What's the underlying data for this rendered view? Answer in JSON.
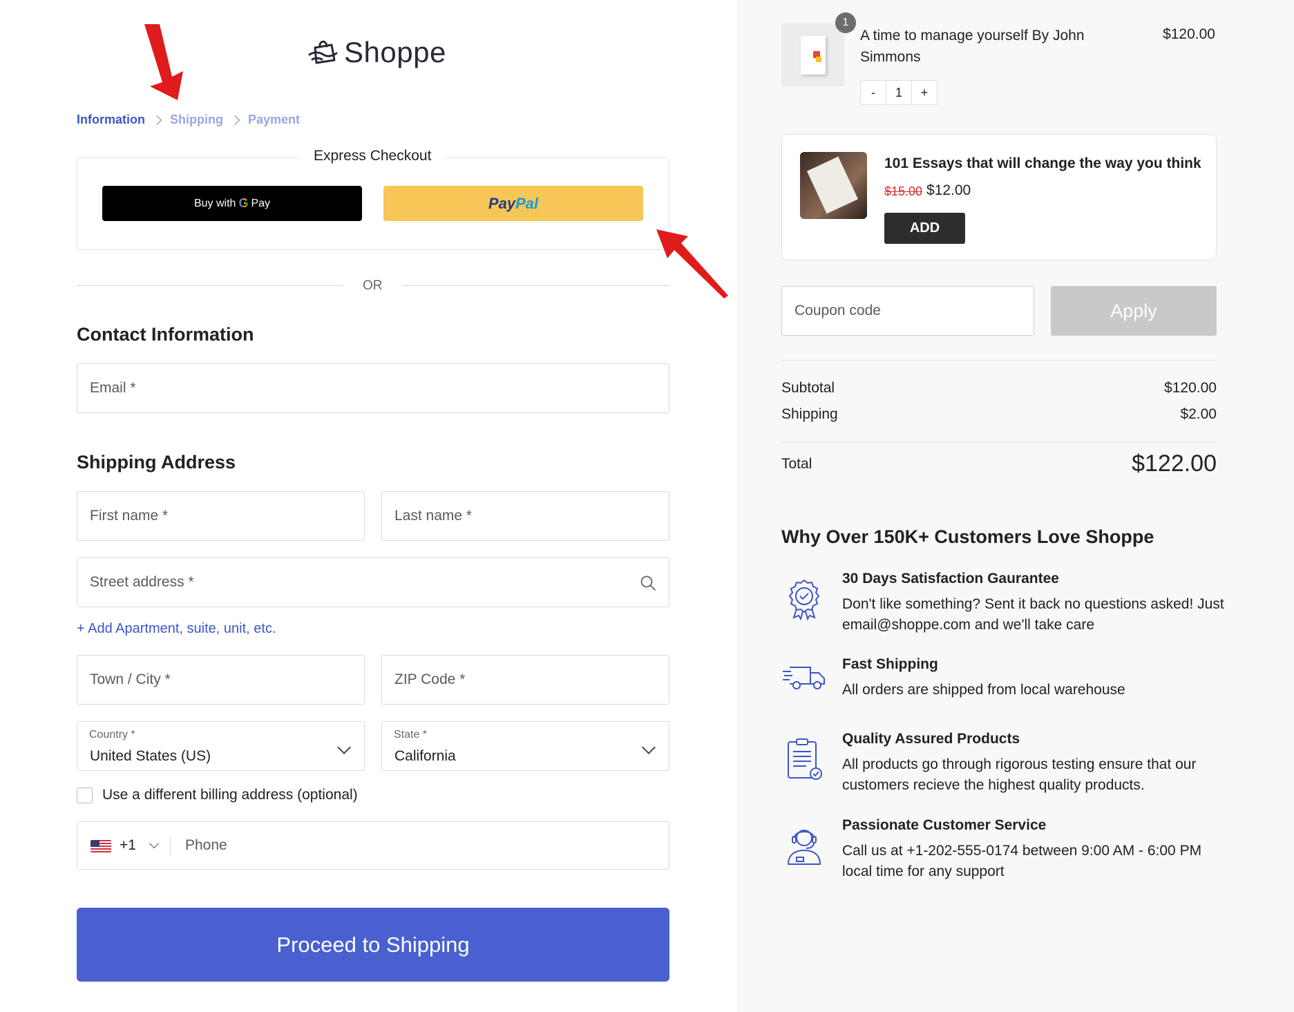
{
  "brand": {
    "name": "Shoppe"
  },
  "breadcrumb": {
    "information": "Information",
    "shipping": "Shipping",
    "payment": "Payment"
  },
  "express": {
    "title": "Express Checkout",
    "gpay_prefix": "Buy with",
    "gpay_g": "G",
    "gpay_suffix": "Pay",
    "paypal_1": "Pay",
    "paypal_2": "Pal",
    "or": "OR"
  },
  "contact": {
    "title": "Contact Information",
    "email_placeholder": "Email *"
  },
  "shipping": {
    "title": "Shipping Address",
    "first_name_placeholder": "First name *",
    "last_name_placeholder": "Last name *",
    "street_placeholder": "Street address *",
    "add_apartment": "+ Add Apartment, suite, unit, etc.",
    "city_placeholder": "Town / City *",
    "zip_placeholder": "ZIP Code *",
    "country_label": "Country *",
    "country_value": "United States (US)",
    "state_label": "State *",
    "state_value": "California",
    "billing_checkbox": "Use a different billing address (optional)",
    "dial_code": "+1",
    "phone_placeholder": "Phone"
  },
  "proceed_button": "Proceed to Shipping",
  "cart": {
    "item": {
      "title": "A time to manage yourself By John Simmons",
      "price": "$120.00",
      "badge": "1",
      "qty_minus": "-",
      "qty": "1",
      "qty_plus": "+"
    },
    "upsell": {
      "title": "101 Essays that will change the way you think",
      "old_price": "$15.00",
      "new_price": "$12.00",
      "add_label": "ADD"
    },
    "coupon_placeholder": "Coupon code",
    "apply_label": "Apply",
    "subtotal_label": "Subtotal",
    "subtotal_value": "$120.00",
    "shipping_label": "Shipping",
    "shipping_value": "$2.00",
    "total_label": "Total",
    "total_value": "$122.00"
  },
  "why": {
    "title": "Why Over 150K+ Customers Love Shoppe",
    "features": [
      {
        "title": "30 Days Satisfaction Gaurantee",
        "desc": "Don't like something? Sent it back no questions asked! Just email@shoppe.com and we'll take care",
        "icon": "badge-check-icon"
      },
      {
        "title": "Fast Shipping",
        "desc": "All orders are shipped from local warehouse",
        "icon": "delivery-truck-icon"
      },
      {
        "title": "Quality Assured Products",
        "desc": "All products go through rigorous testing ensure that our customers recieve the highest quality products.",
        "icon": "clipboard-check-icon"
      },
      {
        "title": "Passionate Customer Service",
        "desc": "Call us at +1-202-555-0174 between 9:00 AM - 6:00 PM local time for any support",
        "icon": "support-agent-icon"
      }
    ]
  },
  "colors": {
    "accent": "#4a60d1",
    "link": "#3d55c8",
    "paypal": "#f6c657",
    "annotation_arrow": "#e01b1b"
  }
}
